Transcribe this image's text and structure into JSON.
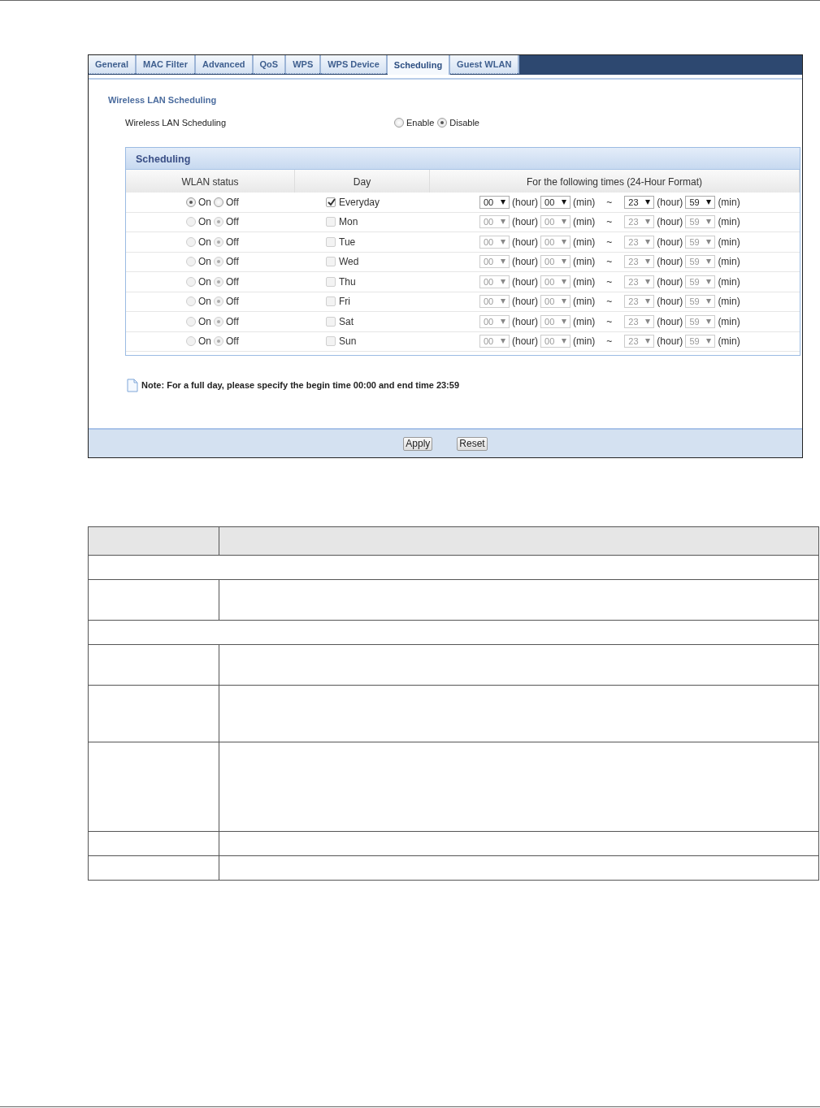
{
  "tabs": [
    {
      "label": "General",
      "selected": false
    },
    {
      "label": "MAC Filter",
      "selected": false
    },
    {
      "label": "Advanced",
      "selected": false
    },
    {
      "label": "QoS",
      "selected": false
    },
    {
      "label": "WPS",
      "selected": false
    },
    {
      "label": "WPS Device",
      "selected": false
    },
    {
      "label": "Scheduling",
      "selected": true
    },
    {
      "label": "Guest WLAN",
      "selected": false
    }
  ],
  "section_title": "Wireless LAN Scheduling",
  "setting": {
    "label": "Wireless LAN Scheduling",
    "options": [
      {
        "label": "Enable",
        "selected": false
      },
      {
        "label": "Disable",
        "selected": true
      }
    ]
  },
  "scheduling": {
    "title": "Scheduling",
    "columns": [
      "WLAN status",
      "Day",
      "For the following times (24-Hour Format)"
    ],
    "rows": [
      {
        "status_options": [
          {
            "label": "On",
            "selected": true
          },
          {
            "label": "Off",
            "selected": false
          }
        ],
        "day": "Everyday",
        "checked": true,
        "disabled": false,
        "start_hour": "00",
        "hour_unit_1": "(hour)",
        "start_min": "00",
        "min_unit_1": "(min)",
        "separator": "~",
        "end_hour": "23",
        "hour_unit_2": "(hour)",
        "end_min": "59",
        "min_unit_2": "(min)"
      },
      {
        "status_options": [
          {
            "label": "On",
            "selected": false
          },
          {
            "label": "Off",
            "selected": true
          }
        ],
        "day": "Mon",
        "checked": false,
        "disabled": true,
        "start_hour": "00",
        "hour_unit_1": "(hour)",
        "start_min": "00",
        "min_unit_1": "(min)",
        "separator": "~",
        "end_hour": "23",
        "hour_unit_2": "(hour)",
        "end_min": "59",
        "min_unit_2": "(min)"
      },
      {
        "status_options": [
          {
            "label": "On",
            "selected": false
          },
          {
            "label": "Off",
            "selected": true
          }
        ],
        "day": "Tue",
        "checked": false,
        "disabled": true,
        "start_hour": "00",
        "hour_unit_1": "(hour)",
        "start_min": "00",
        "min_unit_1": "(min)",
        "separator": "~",
        "end_hour": "23",
        "hour_unit_2": "(hour)",
        "end_min": "59",
        "min_unit_2": "(min)"
      },
      {
        "status_options": [
          {
            "label": "On",
            "selected": false
          },
          {
            "label": "Off",
            "selected": true
          }
        ],
        "day": "Wed",
        "checked": false,
        "disabled": true,
        "start_hour": "00",
        "hour_unit_1": "(hour)",
        "start_min": "00",
        "min_unit_1": "(min)",
        "separator": "~",
        "end_hour": "23",
        "hour_unit_2": "(hour)",
        "end_min": "59",
        "min_unit_2": "(min)"
      },
      {
        "status_options": [
          {
            "label": "On",
            "selected": false
          },
          {
            "label": "Off",
            "selected": true
          }
        ],
        "day": "Thu",
        "checked": false,
        "disabled": true,
        "start_hour": "00",
        "hour_unit_1": "(hour)",
        "start_min": "00",
        "min_unit_1": "(min)",
        "separator": "~",
        "end_hour": "23",
        "hour_unit_2": "(hour)",
        "end_min": "59",
        "min_unit_2": "(min)"
      },
      {
        "status_options": [
          {
            "label": "On",
            "selected": false
          },
          {
            "label": "Off",
            "selected": true
          }
        ],
        "day": "Fri",
        "checked": false,
        "disabled": true,
        "start_hour": "00",
        "hour_unit_1": "(hour)",
        "start_min": "00",
        "min_unit_1": "(min)",
        "separator": "~",
        "end_hour": "23",
        "hour_unit_2": "(hour)",
        "end_min": "59",
        "min_unit_2": "(min)"
      },
      {
        "status_options": [
          {
            "label": "On",
            "selected": false
          },
          {
            "label": "Off",
            "selected": true
          }
        ],
        "day": "Sat",
        "checked": false,
        "disabled": true,
        "start_hour": "00",
        "hour_unit_1": "(hour)",
        "start_min": "00",
        "min_unit_1": "(min)",
        "separator": "~",
        "end_hour": "23",
        "hour_unit_2": "(hour)",
        "end_min": "59",
        "min_unit_2": "(min)"
      },
      {
        "status_options": [
          {
            "label": "On",
            "selected": false
          },
          {
            "label": "Off",
            "selected": true
          }
        ],
        "day": "Sun",
        "checked": false,
        "disabled": true,
        "start_hour": "00",
        "hour_unit_1": "(hour)",
        "start_min": "00",
        "min_unit_1": "(min)",
        "separator": "~",
        "end_hour": "23",
        "hour_unit_2": "(hour)",
        "end_min": "59",
        "min_unit_2": "(min)"
      }
    ]
  },
  "note": "Note: For a full day, please specify the begin time 00:00 and end time 23:59",
  "buttons": [
    "Apply",
    "Reset"
  ],
  "description_table": {
    "rows": [
      {
        "kind": "header"
      },
      {
        "kind": "span"
      },
      {
        "kind": "pair"
      },
      {
        "kind": "span"
      },
      {
        "kind": "pair"
      },
      {
        "kind": "tall"
      },
      {
        "kind": "taller"
      },
      {
        "kind": "pair_short"
      },
      {
        "kind": "pair_short"
      }
    ]
  }
}
